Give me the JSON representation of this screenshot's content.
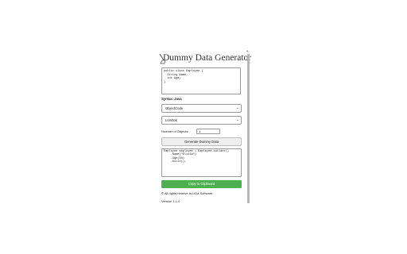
{
  "app": {
    "title": "Dummy Data Generator"
  },
  "input": {
    "code": "public class Employee {\n  String Name;\n  int Age;\n}"
  },
  "syntax_label": "Syntax: Java",
  "selects": {
    "format": "ObjectCode",
    "library": "Lombok"
  },
  "objects": {
    "label": "Number of Objects:",
    "value": "1"
  },
  "buttons": {
    "generate": "Generate Dummy Data",
    "copy": "Copy to Clipboard"
  },
  "output": {
    "code": "Employee employee = Employee.builder()\n    .Name(\"Oliv1a\")\n    .Age(38)\n    .build();"
  },
  "footer": {
    "rights": "© All rights reserve to LiDa Software",
    "version": "Version 1.1.0"
  },
  "colors": {
    "copy_button": "#4caf50",
    "scroll_thumb": "#b5b5b5"
  },
  "icons": {
    "logo": "broom-icon",
    "dropdown": "chevron-down-icon"
  }
}
